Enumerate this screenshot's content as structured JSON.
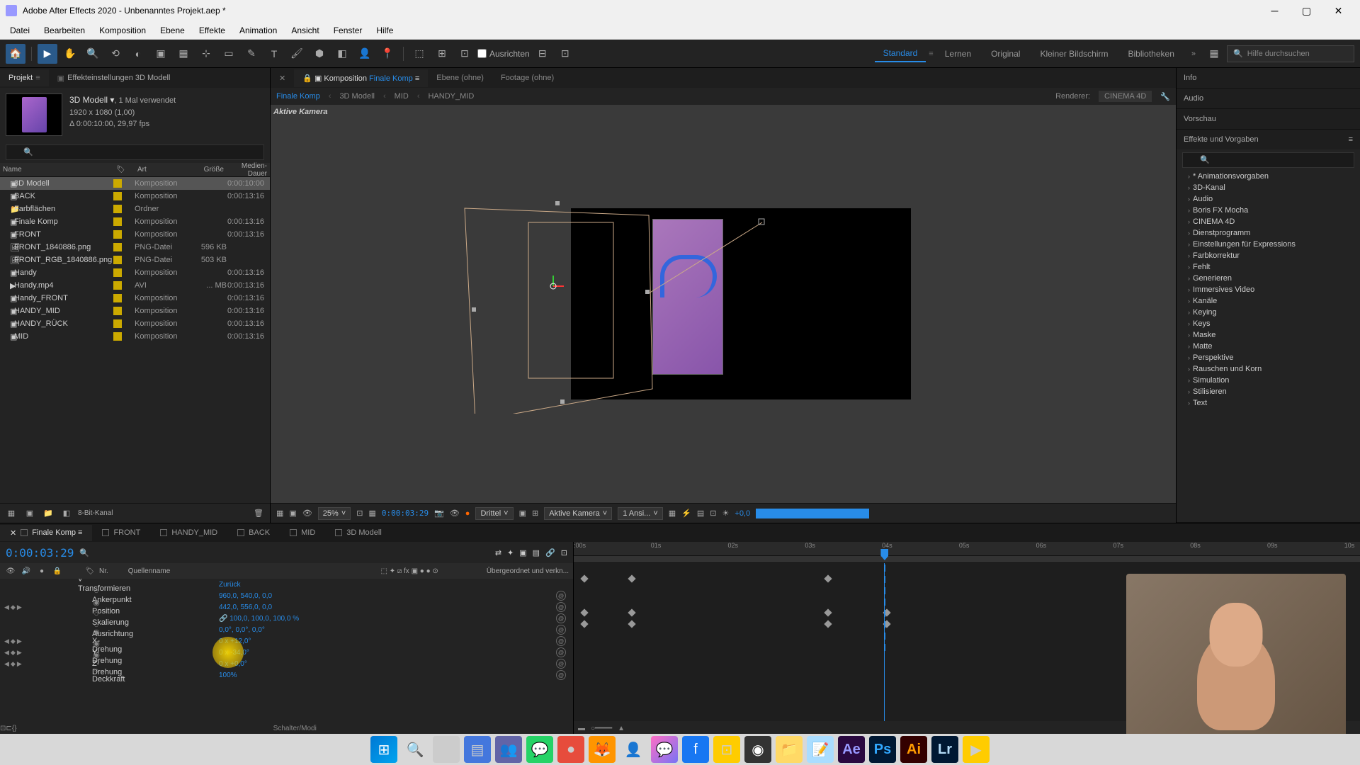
{
  "titlebar": {
    "title": "Adobe After Effects 2020 - Unbenanntes Projekt.aep *"
  },
  "menubar": {
    "items": [
      "Datei",
      "Bearbeiten",
      "Komposition",
      "Ebene",
      "Effekte",
      "Animation",
      "Ansicht",
      "Fenster",
      "Hilfe"
    ]
  },
  "toolbar": {
    "align_label": "Ausrichten",
    "workspaces": [
      "Standard",
      "Lernen",
      "Original",
      "Kleiner Bildschirm",
      "Bibliotheken"
    ],
    "active_workspace": "Standard",
    "search_placeholder": "Hilfe durchsuchen"
  },
  "project": {
    "tab_project": "Projekt",
    "tab_effect": "Effekteinstellungen 3D Modell",
    "comp_name": "3D Modell ▾",
    "comp_usage": ", 1 Mal verwendet",
    "comp_dims": "1920 x 1080 (1,00)",
    "comp_duration": "Δ 0:00:10:00, 29,97 fps",
    "headers": {
      "name": "Name",
      "type": "Art",
      "size": "Größe",
      "duration": "Medien-Dauer"
    },
    "items": [
      {
        "name": "3D Modell",
        "type": "Komposition",
        "size": "",
        "dur": "0:00:10:00",
        "icon": "comp",
        "selected": true
      },
      {
        "name": "BACK",
        "type": "Komposition",
        "size": "",
        "dur": "0:00:13:16",
        "icon": "comp"
      },
      {
        "name": "Farbflächen",
        "type": "Ordner",
        "size": "",
        "dur": "",
        "icon": "folder"
      },
      {
        "name": "Finale Komp",
        "type": "Komposition",
        "size": "",
        "dur": "0:00:13:16",
        "icon": "comp"
      },
      {
        "name": "FRONT",
        "type": "Komposition",
        "size": "",
        "dur": "0:00:13:16",
        "icon": "comp"
      },
      {
        "name": "FRONT_1840886.png",
        "type": "PNG-Datei",
        "size": "596 KB",
        "dur": "",
        "icon": "png"
      },
      {
        "name": "FRONT_RGB_1840886.png",
        "type": "PNG-Datei",
        "size": "503 KB",
        "dur": "",
        "icon": "png"
      },
      {
        "name": "Handy",
        "type": "Komposition",
        "size": "",
        "dur": "0:00:13:16",
        "icon": "comp"
      },
      {
        "name": "Handy.mp4",
        "type": "AVI",
        "size": "... MB",
        "dur": "0:00:13:16",
        "icon": "avi"
      },
      {
        "name": "Handy_FRONT",
        "type": "Komposition",
        "size": "",
        "dur": "0:00:13:16",
        "icon": "comp"
      },
      {
        "name": "HANDY_MID",
        "type": "Komposition",
        "size": "",
        "dur": "0:00:13:16",
        "icon": "comp"
      },
      {
        "name": "HANDY_RÜCK",
        "type": "Komposition",
        "size": "",
        "dur": "0:00:13:16",
        "icon": "comp"
      },
      {
        "name": "MID",
        "type": "Komposition",
        "size": "",
        "dur": "0:00:13:16",
        "icon": "comp"
      }
    ],
    "footer_bitdepth": "8-Bit-Kanal"
  },
  "composition": {
    "tab_comp_prefix": "Komposition",
    "tab_comp_name": "Finale Komp",
    "tab_layer": "Ebene (ohne)",
    "tab_footage": "Footage (ohne)",
    "breadcrumb": [
      "Finale Komp",
      "3D Modell",
      "MID",
      "HANDY_MID"
    ],
    "renderer_label": "Renderer:",
    "renderer_value": "CINEMA 4D",
    "active_camera": "Aktive Kamera",
    "footer": {
      "zoom": "25%",
      "time": "0:00:03:29",
      "resolution": "Drittel",
      "camera": "Aktive Kamera",
      "views": "1 Ansi...",
      "exposure": "+0,0"
    }
  },
  "right": {
    "info": "Info",
    "audio": "Audio",
    "preview": "Vorschau",
    "effects_header": "Effekte und Vorgaben",
    "effects": [
      "* Animationsvorgaben",
      "3D-Kanal",
      "Audio",
      "Boris FX Mocha",
      "CINEMA 4D",
      "Dienstprogramm",
      "Einstellungen für Expressions",
      "Farbkorrektur",
      "Fehlt",
      "Generieren",
      "Immersives Video",
      "Kanäle",
      "Keying",
      "Keys",
      "Maske",
      "Matte",
      "Perspektive",
      "Rauschen und Korn",
      "Simulation",
      "Stilisieren",
      "Text"
    ]
  },
  "timeline": {
    "tabs": [
      "Finale Komp",
      "FRONT",
      "HANDY_MID",
      "BACK",
      "MID",
      "3D Modell"
    ],
    "active_tab": "Finale Komp",
    "timecode": "0:00:03:29",
    "header_nr": "Nr.",
    "header_source": "Quellenname",
    "header_parent": "Übergeordnet und verkn...",
    "transform_label": "Transformieren",
    "transform_reset": "Zurück",
    "props": [
      {
        "name": "Ankerpunkt",
        "value": "960,0, 540,0, 0,0",
        "stopwatch": false
      },
      {
        "name": "Position",
        "value": "442,0, 556,0, 0,0",
        "stopwatch": true,
        "keyed": true
      },
      {
        "name": "Skalierung",
        "value": "100,0, 100,0, 100,0 %",
        "stopwatch": false,
        "link": true
      },
      {
        "name": "Ausrichtung",
        "value": "0,0°, 0,0°, 0,0°",
        "stopwatch": false
      },
      {
        "name": "X-Drehung",
        "value": "0 x +12,0°",
        "stopwatch": true,
        "keyed": true,
        "highlight": true
      },
      {
        "name": "Y-Drehung",
        "value": "0 x -34,0°",
        "stopwatch": true,
        "keyed": true
      },
      {
        "name": "Z-Drehung",
        "value": "0 x +0,0°",
        "stopwatch": true,
        "keyed": true
      },
      {
        "name": "Deckkraft",
        "value": "100%",
        "stopwatch": false
      }
    ],
    "footer_label": "Schalter/Modi",
    "ruler_ticks": [
      ":00s",
      "01s",
      "02s",
      "03s",
      "04s",
      "05s",
      "06s",
      "07s",
      "08s",
      "09s",
      "10s"
    ]
  }
}
